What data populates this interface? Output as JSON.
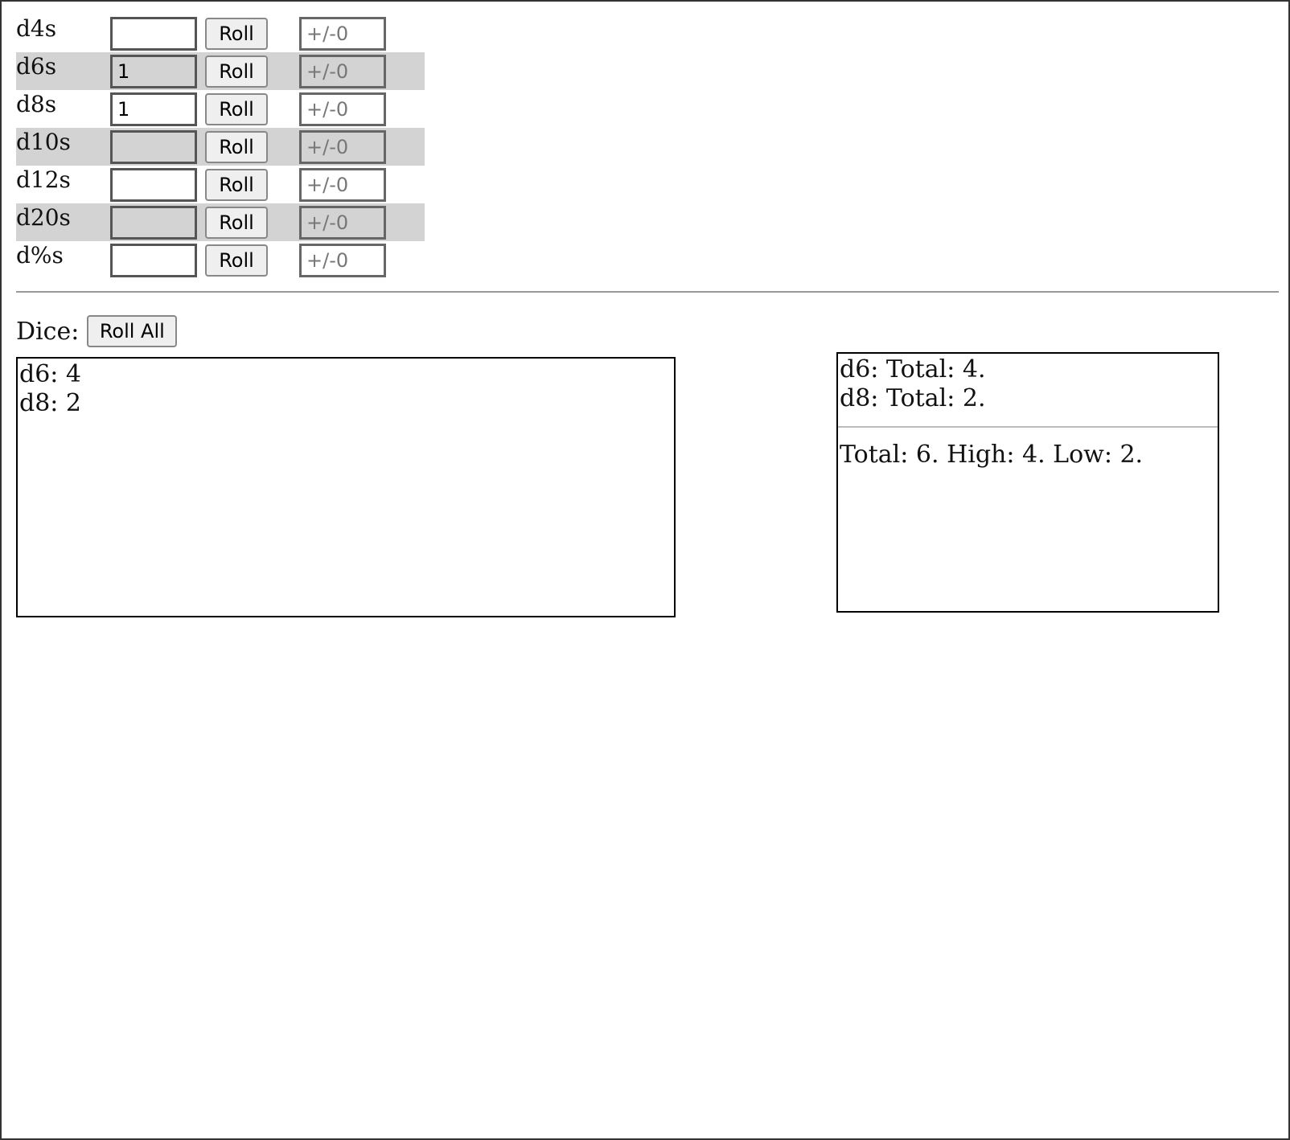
{
  "dice": [
    {
      "label": "d4s",
      "count": "",
      "roll_label": "Roll",
      "mod_placeholder": "+/-0"
    },
    {
      "label": "d6s",
      "count": "1",
      "roll_label": "Roll",
      "mod_placeholder": "+/-0"
    },
    {
      "label": "d8s",
      "count": "1",
      "roll_label": "Roll",
      "mod_placeholder": "+/-0"
    },
    {
      "label": "d10s",
      "count": "",
      "roll_label": "Roll",
      "mod_placeholder": "+/-0"
    },
    {
      "label": "d12s",
      "count": "",
      "roll_label": "Roll",
      "mod_placeholder": "+/-0"
    },
    {
      "label": "d20s",
      "count": "",
      "roll_label": "Roll",
      "mod_placeholder": "+/-0"
    },
    {
      "label": "d%s",
      "count": "",
      "roll_label": "Roll",
      "mod_placeholder": "+/-0"
    }
  ],
  "dice_bar": {
    "label": "Dice:",
    "roll_all_label": "Roll All"
  },
  "results": {
    "lines": [
      "d6: 4",
      "d8: 2"
    ]
  },
  "summary": {
    "lines": [
      "d6: Total: 4.",
      "d8: Total: 2."
    ],
    "overall": "Total: 6. High: 4. Low: 2."
  },
  "colors": {
    "alt_row": "#d3d3d3",
    "border": "#000000"
  }
}
